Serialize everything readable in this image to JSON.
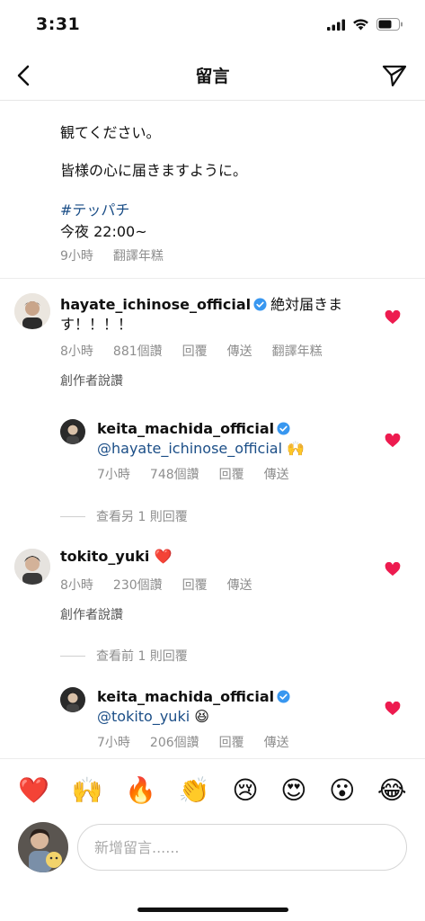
{
  "status": {
    "time": "3:31"
  },
  "header": {
    "title": "留言"
  },
  "caption": {
    "lines": [
      "観てください。",
      "皆様の心に届きますように。",
      "#テッパチ",
      "今夜 22:00~"
    ],
    "time": "9小時",
    "translate": "翻譯年糕"
  },
  "comments": [
    {
      "username": "hayate_ichinose_official",
      "verified": true,
      "text_line1": "絶対届きま",
      "text_line2": "す！！！！",
      "time": "8小時",
      "likes": "881個讚",
      "reply": "回覆",
      "send": "傳送",
      "translate": "翻譯年糕",
      "creator_liked": "創作者說讚",
      "reply_item": {
        "username": "keita_machida_official",
        "verified": true,
        "mention": "@hayate_ichinose_official",
        "emoji": "🙌",
        "time": "7小時",
        "likes": "748個讚",
        "reply": "回覆",
        "send": "傳送"
      },
      "view_more": "查看另 1 則回覆"
    },
    {
      "username": "tokito_yuki",
      "text": "❤️",
      "time": "8小時",
      "likes": "230個讚",
      "reply": "回覆",
      "send": "傳送",
      "creator_liked": "創作者說讚",
      "view_prev": "查看前 1 則回覆",
      "reply_item": {
        "username": "keita_machida_official",
        "verified": true,
        "mention": "@tokito_yuki",
        "emoji": "😆",
        "time": "7小時",
        "likes": "206個讚",
        "reply": "回覆",
        "send": "傳送"
      }
    }
  ],
  "quick_emojis": [
    "❤️",
    "🙌",
    "🔥",
    "👏",
    "😢",
    "😍",
    "😮",
    "😂"
  ],
  "composer": {
    "placeholder": "新增留言......"
  },
  "colors": {
    "like_red": "#ed1b4f",
    "verified_blue": "#3897f0",
    "link_blue": "#1b4e87",
    "muted": "#8e8e8e"
  }
}
